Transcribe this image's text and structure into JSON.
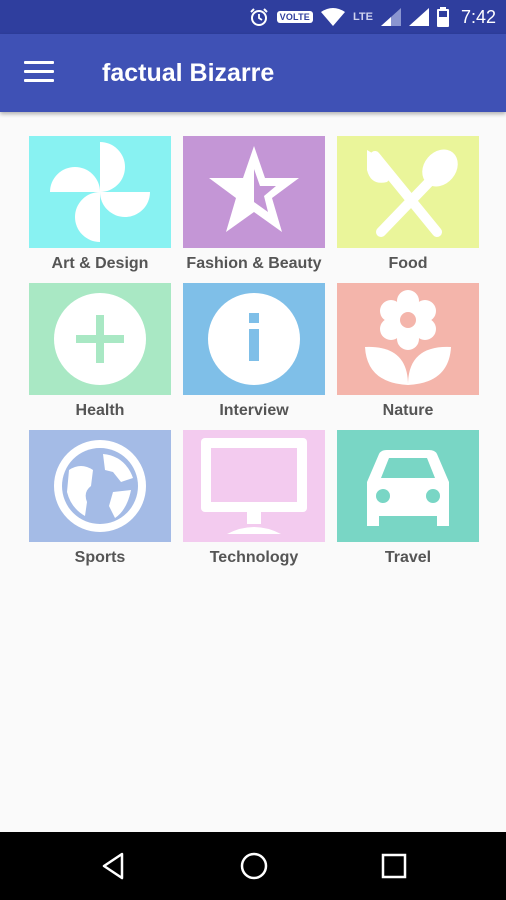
{
  "status_bar": {
    "volte_label": "VOLTE",
    "lte_label": "LTE",
    "time": "7:42",
    "icons": [
      "alarm-icon",
      "wifi-icon",
      "signal-icon",
      "battery-icon"
    ]
  },
  "app_bar": {
    "title": "factual Bizarre",
    "menu_icon": "hamburger-menu-icon",
    "color": "#3f51b5"
  },
  "categories": [
    {
      "label": "Art & Design",
      "icon": "pinwheel-icon",
      "color": "#88f2f2"
    },
    {
      "label": "Fashion & Beauty",
      "icon": "star-icon",
      "color": "#c496d6"
    },
    {
      "label": "Food",
      "icon": "fork-spoon-icon",
      "color": "#eaf59a"
    },
    {
      "label": "Health",
      "icon": "plus-icon",
      "color": "#a9e8c4"
    },
    {
      "label": "Interview",
      "icon": "info-icon",
      "color": "#7fbfe8"
    },
    {
      "label": "Nature",
      "icon": "flower-icon",
      "color": "#f4b5ab"
    },
    {
      "label": "Sports",
      "icon": "globe-icon",
      "color": "#a4bbe6"
    },
    {
      "label": "Technology",
      "icon": "monitor-icon",
      "color": "#f3cbef"
    },
    {
      "label": "Travel",
      "icon": "car-icon",
      "color": "#79d6c5"
    }
  ],
  "nav_bar": {
    "buttons": [
      "back-icon",
      "home-icon",
      "recents-icon"
    ]
  }
}
